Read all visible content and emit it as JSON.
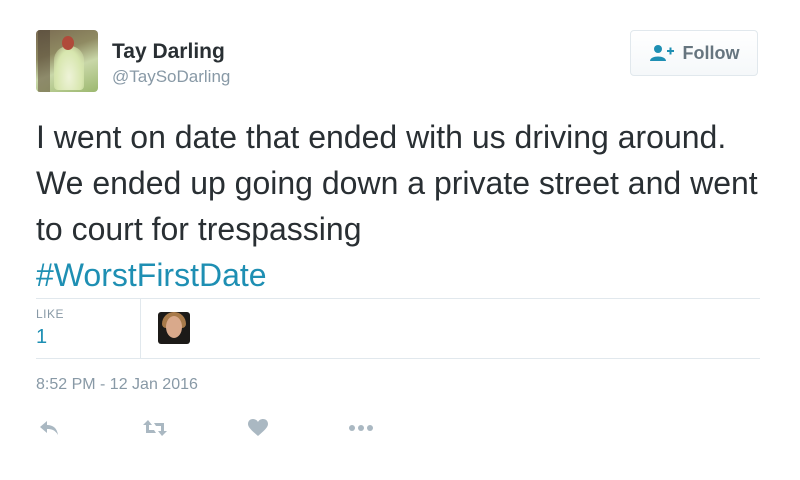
{
  "user": {
    "name": "Tay Darling",
    "handle": "@TaySoDarling"
  },
  "follow_button": {
    "label": "Follow",
    "icon": "add-user-icon"
  },
  "tweet": {
    "text": "I went on date that ended with us driving around. We ended up going down a private street and went to court for trespassing",
    "hashtag": "#WorstFirstDate"
  },
  "stats": {
    "like_label": "LIKE",
    "like_count": "1"
  },
  "timestamp": "8:52 PM - 12 Jan 2016",
  "actions": {
    "reply_icon": "reply-icon",
    "retweet_icon": "retweet-icon",
    "like_icon": "heart-icon",
    "more_icon": "more-icon"
  },
  "colors": {
    "link": "#1e8fb3",
    "muted": "#8899a6",
    "text": "#292f33",
    "icon": "#aab8c2",
    "border": "#e1e8ed"
  }
}
